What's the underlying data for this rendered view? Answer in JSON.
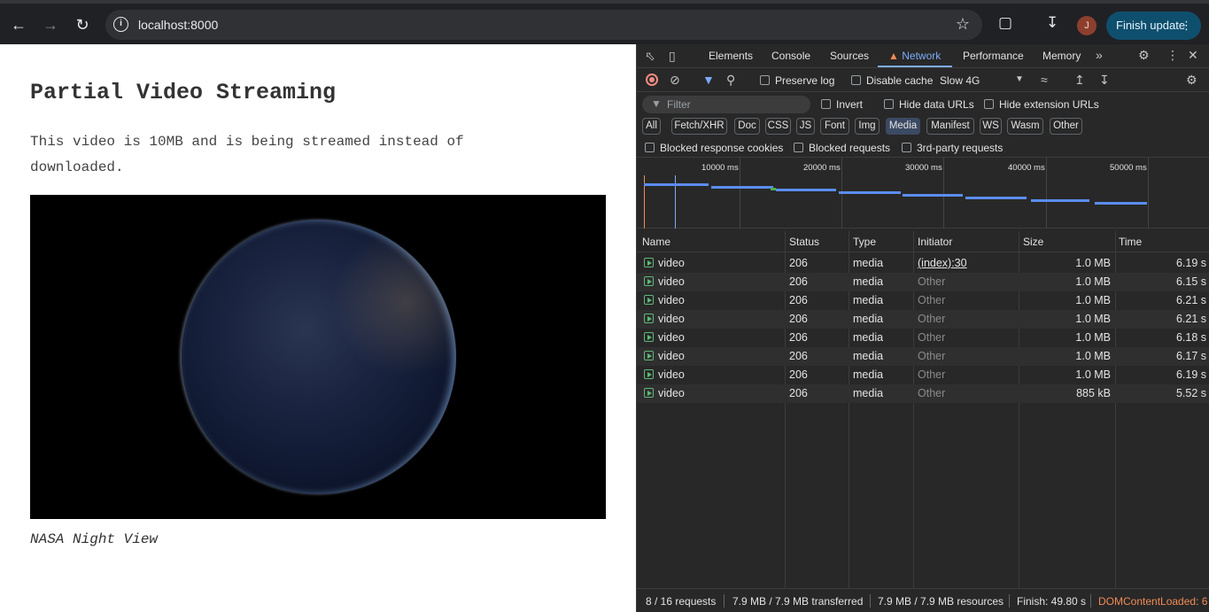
{
  "browser": {
    "url": "localhost:8000",
    "avatar_initial": "J",
    "finish_update_label": "Finish update"
  },
  "page": {
    "title": "Partial Video Streaming",
    "description": "This video is 10MB and is being streamed instead of downloaded.",
    "caption": "NASA Night View"
  },
  "devtools": {
    "tabs": [
      "Elements",
      "Console",
      "Sources",
      "Network",
      "Performance",
      "Memory"
    ],
    "active_tab": "Network",
    "toolbar": {
      "preserve_log": "Preserve log",
      "disable_cache": "Disable cache",
      "throttling": "Slow 4G"
    },
    "filter": {
      "placeholder": "Filter",
      "invert": "Invert",
      "hide_data_urls": "Hide data URLs",
      "hide_extension_urls": "Hide extension URLs"
    },
    "type_chips": [
      "All",
      "Fetch/XHR",
      "Doc",
      "CSS",
      "JS",
      "Font",
      "Img",
      "Media",
      "Manifest",
      "WS",
      "Wasm",
      "Other"
    ],
    "active_chip": "Media",
    "blocked": {
      "response_cookies": "Blocked response cookies",
      "requests": "Blocked requests",
      "third_party": "3rd-party requests"
    },
    "overview_ticks": [
      "10000 ms",
      "20000 ms",
      "30000 ms",
      "40000 ms",
      "50000 ms"
    ],
    "columns": {
      "name": "Name",
      "status": "Status",
      "type": "Type",
      "initiator": "Initiator",
      "size": "Size",
      "time": "Time"
    },
    "rows": [
      {
        "name": "video",
        "status": "206",
        "type": "media",
        "initiator": "(index):30",
        "size": "1.0 MB",
        "time": "6.19 s"
      },
      {
        "name": "video",
        "status": "206",
        "type": "media",
        "initiator": "Other",
        "size": "1.0 MB",
        "time": "6.15 s"
      },
      {
        "name": "video",
        "status": "206",
        "type": "media",
        "initiator": "Other",
        "size": "1.0 MB",
        "time": "6.21 s"
      },
      {
        "name": "video",
        "status": "206",
        "type": "media",
        "initiator": "Other",
        "size": "1.0 MB",
        "time": "6.21 s"
      },
      {
        "name": "video",
        "status": "206",
        "type": "media",
        "initiator": "Other",
        "size": "1.0 MB",
        "time": "6.18 s"
      },
      {
        "name": "video",
        "status": "206",
        "type": "media",
        "initiator": "Other",
        "size": "1.0 MB",
        "time": "6.17 s"
      },
      {
        "name": "video",
        "status": "206",
        "type": "media",
        "initiator": "Other",
        "size": "1.0 MB",
        "time": "6.19 s"
      },
      {
        "name": "video",
        "status": "206",
        "type": "media",
        "initiator": "Other",
        "size": "885 kB",
        "time": "5.52 s"
      }
    ],
    "status_bar": {
      "requests": "8 / 16 requests",
      "transferred": "7.9 MB / 7.9 MB transferred",
      "resources": "7.9 MB / 7.9 MB resources",
      "finish": "Finish: 49.80 s",
      "dom_content_loaded": "DOMContentLoaded: 6"
    },
    "colors": {
      "accent": "#7cacf8",
      "warning": "#f28b54",
      "record": "#f28b82"
    }
  }
}
